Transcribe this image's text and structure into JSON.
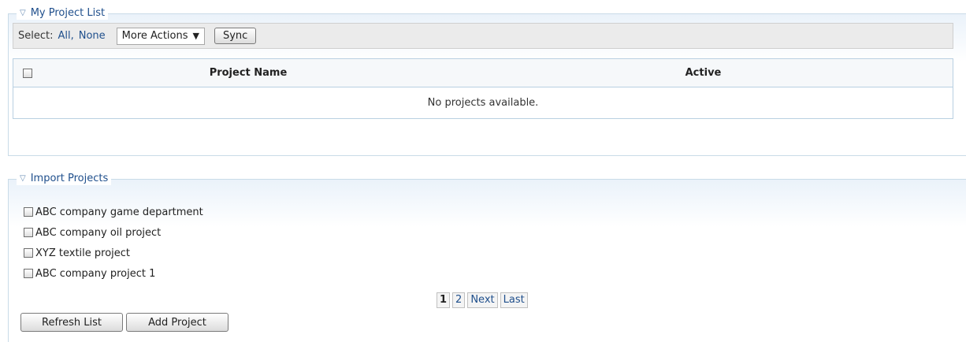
{
  "project_list": {
    "legend": "My Project List",
    "toolbar": {
      "select_label": "Select:",
      "all_link": "All,",
      "none_link": "None",
      "more_actions": "More Actions",
      "more_actions_arrow": "▼",
      "sync_button": "Sync"
    },
    "table": {
      "columns": [
        "Project Name",
        "Active"
      ],
      "empty_message": "No projects available."
    }
  },
  "import_projects": {
    "legend": "Import Projects",
    "items": [
      {
        "label": "ABC company game department"
      },
      {
        "label": "ABC company oil project"
      },
      {
        "label": "XYZ textile project"
      },
      {
        "label": "ABC company project 1"
      }
    ],
    "pager": {
      "current": "1",
      "page2": "2",
      "next": "Next",
      "last": "Last"
    },
    "refresh_button": "Refresh List",
    "add_button": "Add Project"
  },
  "icons": {
    "collapse": "collapse-triangle-icon"
  }
}
